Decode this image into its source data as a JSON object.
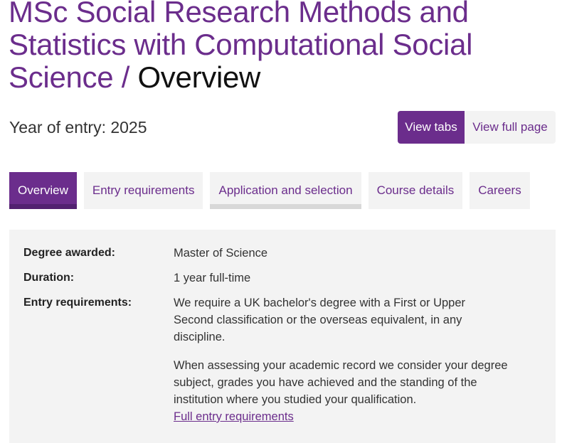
{
  "header": {
    "course_title": "MSc Social Research Methods and Statistics with Computational Social Science",
    "separator": " / ",
    "current_section": "Overview"
  },
  "entry": {
    "year_text": "Year of entry: 2025"
  },
  "view_toggle": {
    "tabs_label": "View tabs",
    "full_page_label": "View full page"
  },
  "tabs": [
    {
      "label": "Overview",
      "active": true
    },
    {
      "label": "Entry requirements",
      "active": false
    },
    {
      "label": "Application and selection",
      "active": false
    },
    {
      "label": "Course details",
      "active": false
    },
    {
      "label": "Careers",
      "active": false
    }
  ],
  "summary": {
    "degree_label": "Degree awarded:",
    "degree_value": "Master of Science",
    "duration_label": "Duration:",
    "duration_value": "1 year full-time",
    "entry_label": "Entry requirements:",
    "entry_para1": "We require a UK bachelor's degree with a First or Upper Second classification or the overseas equivalent, in any discipline.",
    "entry_para2": "When assessing your academic record we consider your degree subject, grades you have achieved and the standing of the institution where you studied your qualification.",
    "entry_link": "Full entry requirements"
  },
  "colors": {
    "brand_purple": "#6b2d8c",
    "panel_grey": "#f3f3f3"
  }
}
